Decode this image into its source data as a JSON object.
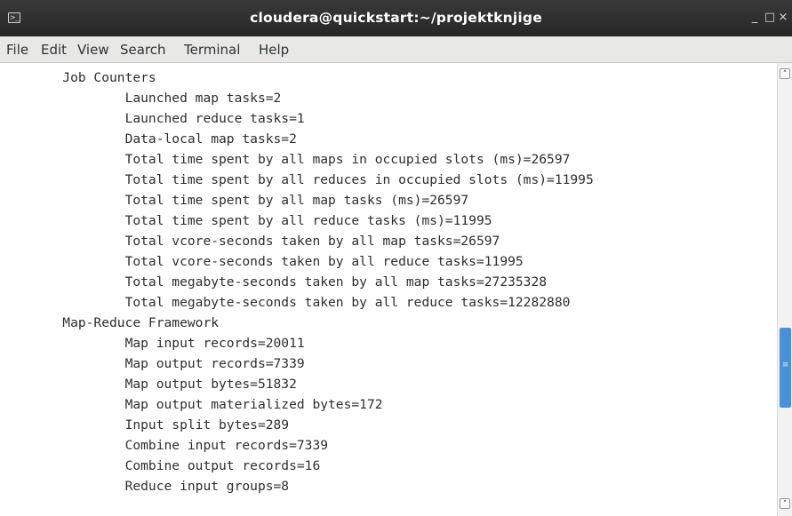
{
  "window": {
    "title": "cloudera@quickstart:~/projektknjige",
    "minimize_glyph": "_",
    "maximize_glyph": "□",
    "close_glyph": "×"
  },
  "menu": [
    "File",
    "Edit",
    "View",
    "Search",
    "Terminal",
    "Help"
  ],
  "terminal": {
    "lines": [
      "        Job Counters ",
      "                Launched map tasks=2",
      "                Launched reduce tasks=1",
      "                Data-local map tasks=2",
      "                Total time spent by all maps in occupied slots (ms)=26597",
      "                Total time spent by all reduces in occupied slots (ms)=11995",
      "                Total time spent by all map tasks (ms)=26597",
      "                Total time spent by all reduce tasks (ms)=11995",
      "                Total vcore-seconds taken by all map tasks=26597",
      "                Total vcore-seconds taken by all reduce tasks=11995",
      "                Total megabyte-seconds taken by all map tasks=27235328",
      "                Total megabyte-seconds taken by all reduce tasks=12282880",
      "        Map-Reduce Framework",
      "                Map input records=20011",
      "                Map output records=7339",
      "                Map output bytes=51832",
      "                Map output materialized bytes=172",
      "                Input split bytes=289",
      "                Combine input records=7339",
      "                Combine output records=16",
      "                Reduce input groups=8"
    ]
  },
  "scrollbar": {
    "position_fraction": 0.72,
    "grip_glyph": "≡",
    "up_glyph": "˄",
    "down_glyph": "˅"
  },
  "colors": {
    "titlebar": "#2b2b2b",
    "menubar": "#e8e8e7",
    "scroll_thumb": "#4a90d9",
    "text": "#2e2e2e"
  }
}
